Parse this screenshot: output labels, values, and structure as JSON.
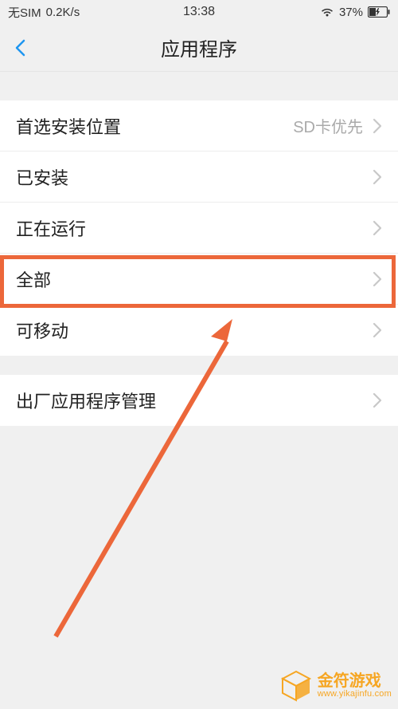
{
  "status": {
    "sim": "无SIM",
    "speed": "0.2K/s",
    "time": "13:38",
    "battery_pct": "37%"
  },
  "nav": {
    "title": "应用程序"
  },
  "rows": {
    "install_location": {
      "label": "首选安装位置",
      "value": "SD卡优先"
    },
    "installed": {
      "label": "已安装"
    },
    "running": {
      "label": "正在运行"
    },
    "all": {
      "label": "全部"
    },
    "movable": {
      "label": "可移动"
    },
    "factory": {
      "label": "出厂应用程序管理"
    }
  },
  "watermark": {
    "main": "金符游戏",
    "sub": "www.yikajinfu.com"
  }
}
